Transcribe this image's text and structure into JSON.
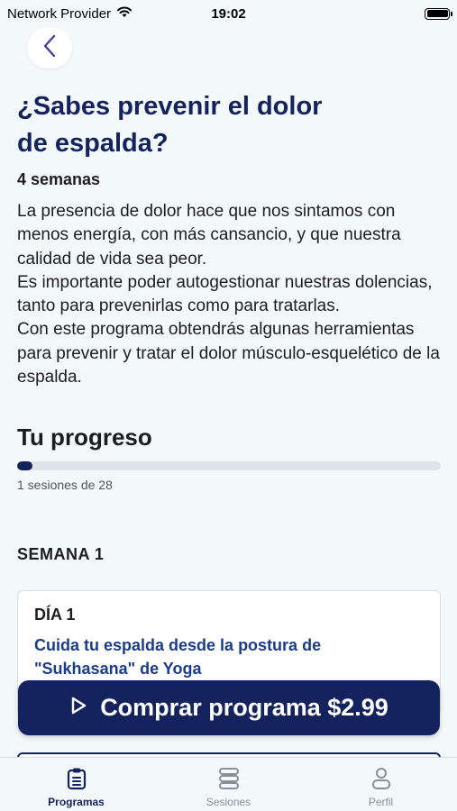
{
  "status_bar": {
    "carrier": "Network Provider",
    "time": "19:02"
  },
  "header": {
    "title_line1": "¿Sabes prevenir el dolor",
    "title_line2": "de espalda?",
    "duration": "4 semanas"
  },
  "description": [
    "La presencia de dolor hace que nos sintamos con menos energía, con más cansancio, y que nuestra calidad de vida sea peor.",
    "Es importante poder autogestionar nuestras dolencias, tanto para prevenirlas como para tratarlas.",
    "Con este programa obtendrás algunas herramientas para prevenir y tratar el dolor músculo-esquelético de la espalda."
  ],
  "progress": {
    "title": "Tu progreso",
    "completed": 1,
    "total": 28,
    "text": "1 sesiones de 28"
  },
  "week": {
    "label": "SEMANA 1",
    "days": [
      {
        "label": "DÍA 1",
        "session": "Cuida tu espalda desde la postura de \"Sukhasana\" de Yoga"
      }
    ]
  },
  "buy_button": {
    "label": "Comprar programa $2.99",
    "icon": "play-outline-icon"
  },
  "tab_bar": {
    "items": [
      {
        "label": "Programas",
        "icon": "clipboard-icon",
        "active": true
      },
      {
        "label": "Sesiones",
        "icon": "stack-icon",
        "active": false
      },
      {
        "label": "Perfil",
        "icon": "person-icon",
        "active": false
      }
    ]
  },
  "colors": {
    "brand": "#14235e",
    "link": "#1b3b8c",
    "background": "#f3f9fa"
  }
}
